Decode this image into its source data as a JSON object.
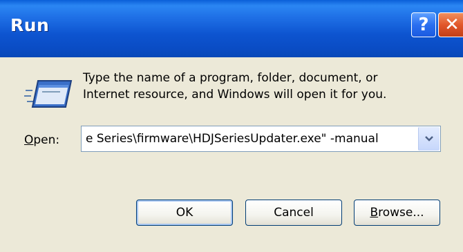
{
  "window": {
    "title": "Run"
  },
  "titlebar": {
    "help_label": "?",
    "close_label": "✕"
  },
  "dialog": {
    "description_line1": "Type the name of a program, folder, document, or",
    "description_line2": "Internet resource, and Windows will open it for you.",
    "open_label_mnemonic": "O",
    "open_label_rest": "pen:",
    "open_value": "e Series\\firmware\\HDJSeriesUpdater.exe\" -manual"
  },
  "buttons": {
    "ok": "OK",
    "cancel": "Cancel",
    "browse_mnemonic": "B",
    "browse_rest": "rowse..."
  },
  "colors": {
    "titlebar_blue": "#0a4cc4",
    "dialog_bg": "#ece9d8",
    "close_red": "#e2572a"
  }
}
